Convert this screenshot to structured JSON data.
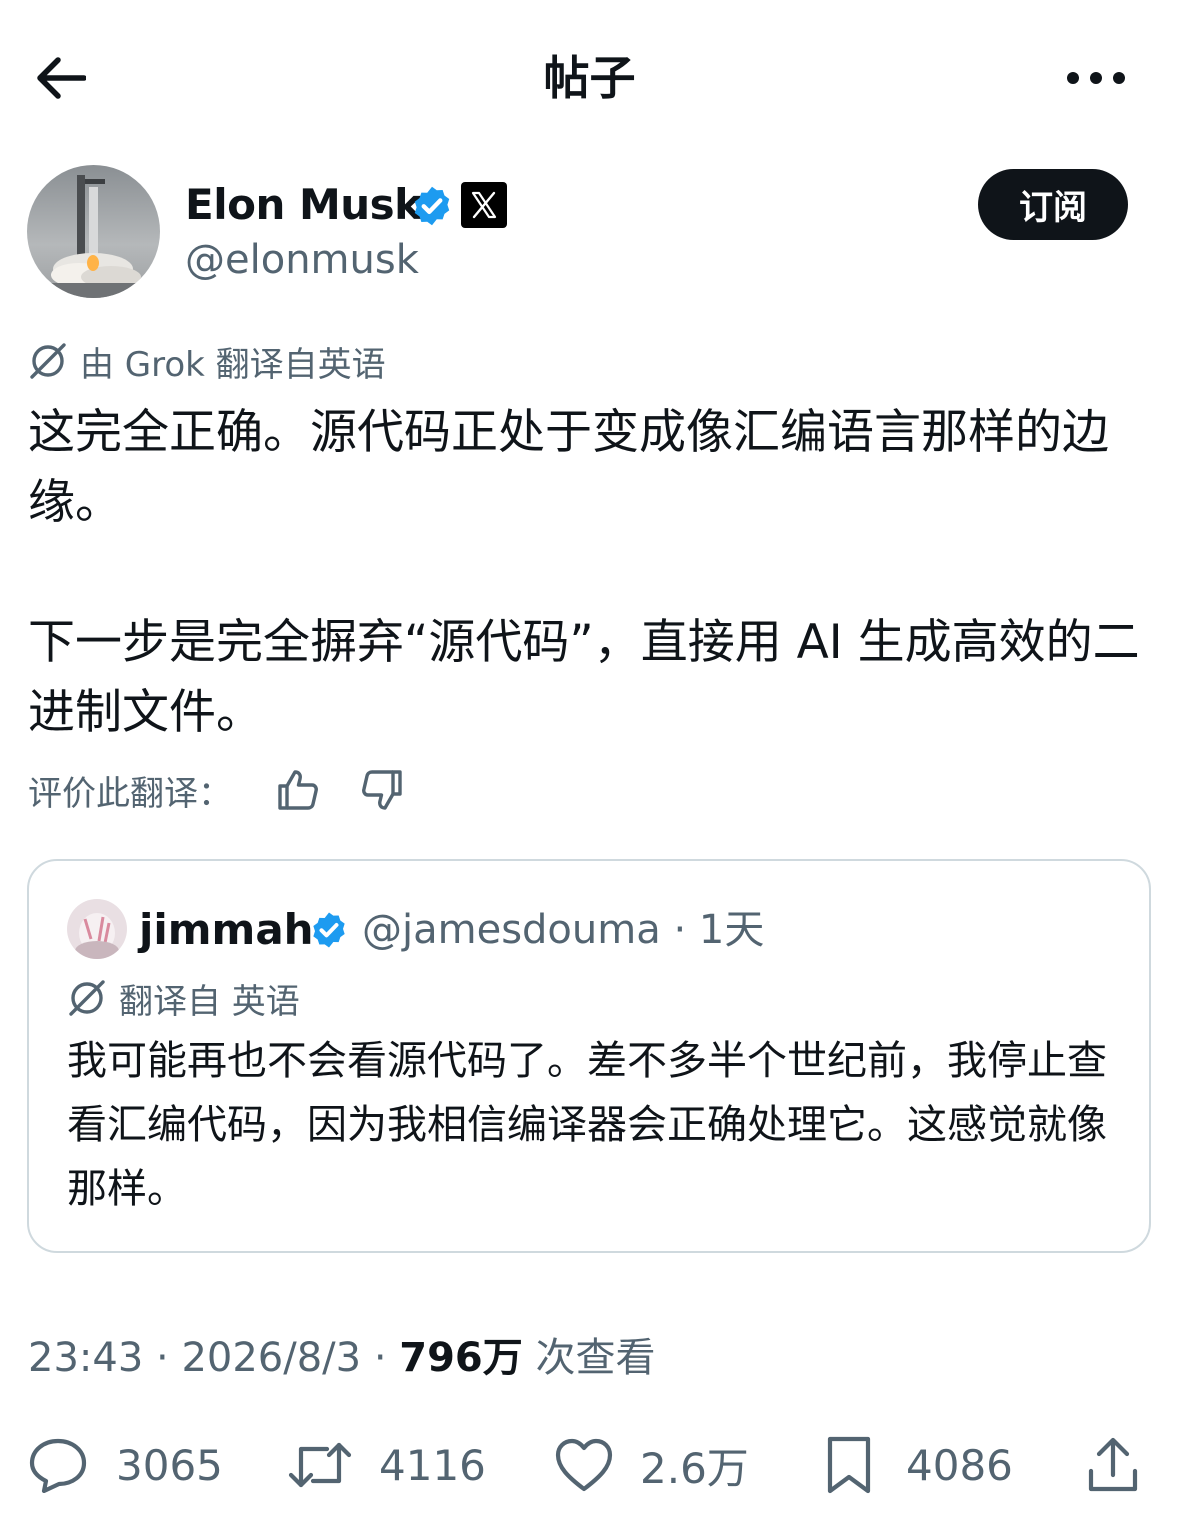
{
  "header": {
    "title": "帖子",
    "back_icon": "arrow-left-icon",
    "more_icon": "more-horizontal-icon"
  },
  "author": {
    "name": "Elon Musk",
    "handle": "@elonmusk",
    "verified": true,
    "affiliation_badge": "x-logo",
    "subscribe_label": "订阅"
  },
  "translation": {
    "note": "由 Grok 翻译自英语"
  },
  "tweet": {
    "paragraph1": "这完全正确。源代码正处于变成像汇编语言那样的边缘。",
    "paragraph2": "下一步是完全摒弃“源代码”，直接用 AI 生成高效的二进制文件。"
  },
  "rate": {
    "label": "评价此翻译："
  },
  "quote": {
    "name": "jimmah",
    "handle_time": "@jamesdouma · 1天",
    "translated_note": "翻译自 英语",
    "text": "我可能再也不会看源代码了。差不多半个世纪前，我停止查看汇编代码，因为我相信编译器会正确处理它。这感觉就像那样。"
  },
  "meta": {
    "time": "23:43",
    "date": "2026/8/3",
    "views": "796万",
    "views_label": "次查看"
  },
  "stats": {
    "replies": "3065",
    "reposts": "4116",
    "likes": "2.6万",
    "bookmarks": "4086"
  },
  "colors": {
    "text_primary": "#0f1419",
    "text_secondary": "#536471",
    "verified_blue": "#1d9bf0",
    "border": "#cfd9de"
  }
}
